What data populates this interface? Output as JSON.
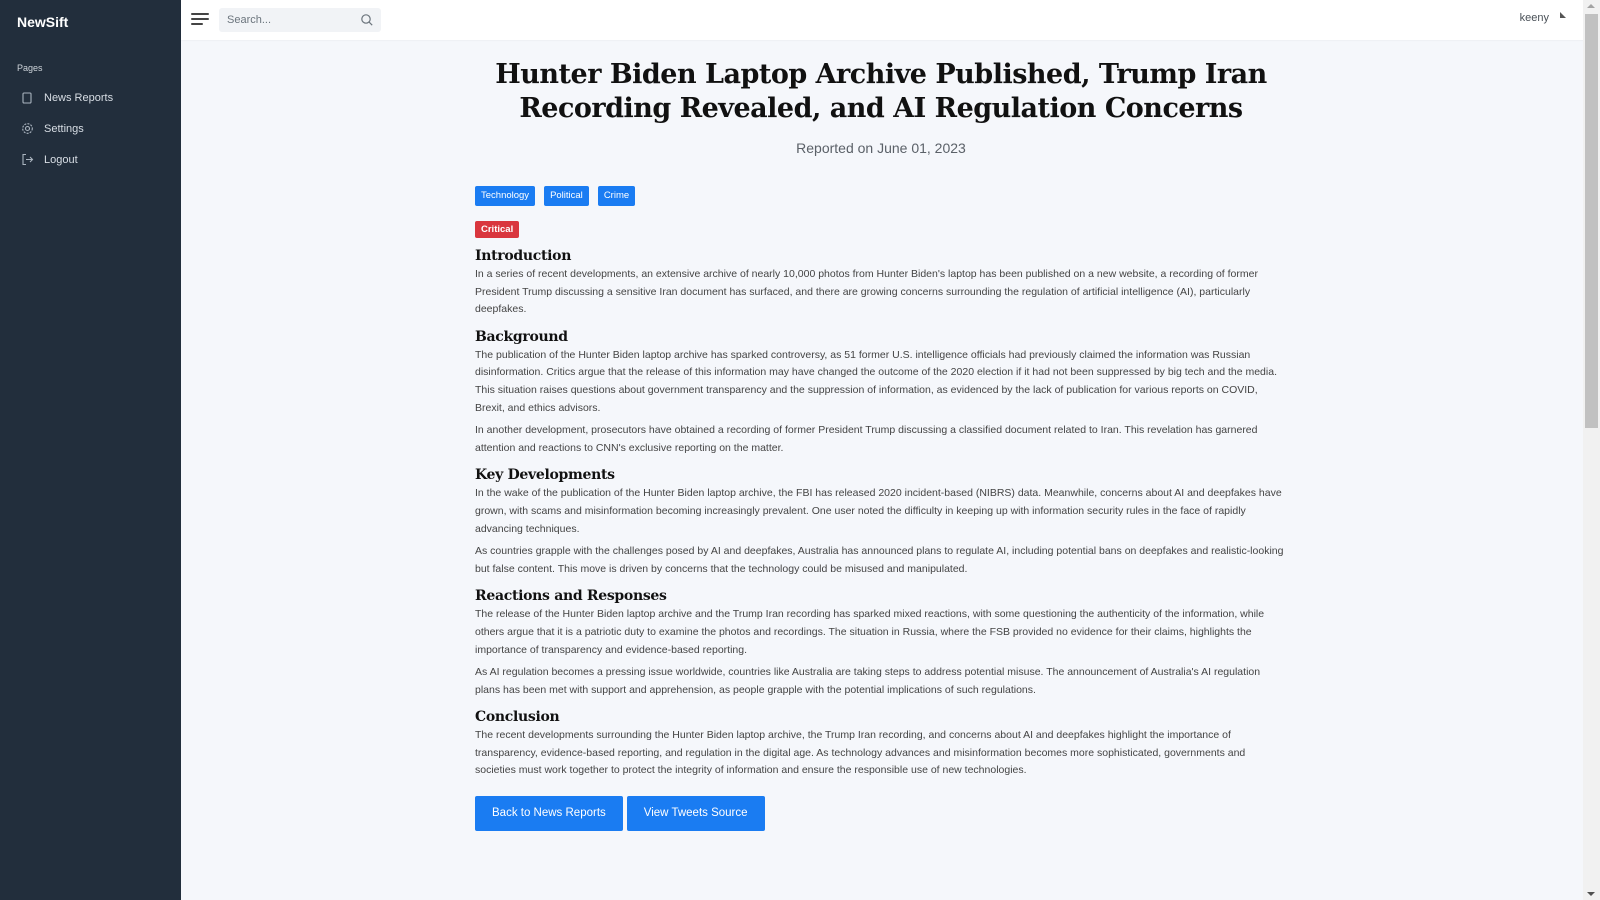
{
  "app": {
    "brand": "NewSift"
  },
  "sidebar": {
    "header": "Pages",
    "items": [
      {
        "label": "News Reports",
        "icon": "document-icon"
      },
      {
        "label": "Settings",
        "icon": "gear-icon"
      },
      {
        "label": "Logout",
        "icon": "logout-icon"
      }
    ]
  },
  "topbar": {
    "search_placeholder": "Search...",
    "username": "keeny"
  },
  "article": {
    "title": "Hunter Biden Laptop Archive Published, Trump Iran Recording Revealed, and AI Regulation Concerns",
    "date": "Reported on June 01, 2023",
    "tags": [
      "Technology",
      "Political",
      "Crime"
    ],
    "severity": "Critical",
    "sections": [
      {
        "heading": "Introduction",
        "paragraphs": [
          "In a series of recent developments, an extensive archive of nearly 10,000 photos from Hunter Biden's laptop has been published on a new website, a recording of former President Trump discussing a sensitive Iran document has surfaced, and there are growing concerns surrounding the regulation of artificial intelligence (AI), particularly deepfakes."
        ]
      },
      {
        "heading": "Background",
        "paragraphs": [
          "The publication of the Hunter Biden laptop archive has sparked controversy, as 51 former U.S. intelligence officials had previously claimed the information was Russian disinformation. Critics argue that the release of this information may have changed the outcome of the 2020 election if it had not been suppressed by big tech and the media. This situation raises questions about government transparency and the suppression of information, as evidenced by the lack of publication for various reports on COVID, Brexit, and ethics advisors.",
          "In another development, prosecutors have obtained a recording of former President Trump discussing a classified document related to Iran. This revelation has garnered attention and reactions to CNN's exclusive reporting on the matter."
        ]
      },
      {
        "heading": "Key Developments",
        "paragraphs": [
          "In the wake of the publication of the Hunter Biden laptop archive, the FBI has released 2020 incident-based (NIBRS) data. Meanwhile, concerns about AI and deepfakes have grown, with scams and misinformation becoming increasingly prevalent. One user noted the difficulty in keeping up with information security rules in the face of rapidly advancing techniques.",
          "As countries grapple with the challenges posed by AI and deepfakes, Australia has announced plans to regulate AI, including potential bans on deepfakes and realistic-looking but false content. This move is driven by concerns that the technology could be misused and manipulated."
        ]
      },
      {
        "heading": "Reactions and Responses",
        "paragraphs": [
          "The release of the Hunter Biden laptop archive and the Trump Iran recording has sparked mixed reactions, with some questioning the authenticity of the information, while others argue that it is a patriotic duty to examine the photos and recordings. The situation in Russia, where the FSB provided no evidence for their claims, highlights the importance of transparency and evidence-based reporting.",
          "As AI regulation becomes a pressing issue worldwide, countries like Australia are taking steps to address potential misuse. The announcement of Australia's AI regulation plans has been met with support and apprehension, as people grapple with the potential implications of such regulations."
        ]
      },
      {
        "heading": "Conclusion",
        "paragraphs": [
          "The recent developments surrounding the Hunter Biden laptop archive, the Trump Iran recording, and concerns about AI and deepfakes highlight the importance of transparency, evidence-based reporting, and regulation in the digital age. As technology advances and misinformation becomes more sophisticated, governments and societies must work together to protect the integrity of information and ensure the responsible use of new technologies."
        ]
      }
    ],
    "buttons": {
      "back": "Back to News Reports",
      "tweets": "View Tweets Source"
    }
  },
  "colors": {
    "sidebar_bg": "#222e3c",
    "accent": "#1a7cf2",
    "critical": "#d9363e"
  }
}
